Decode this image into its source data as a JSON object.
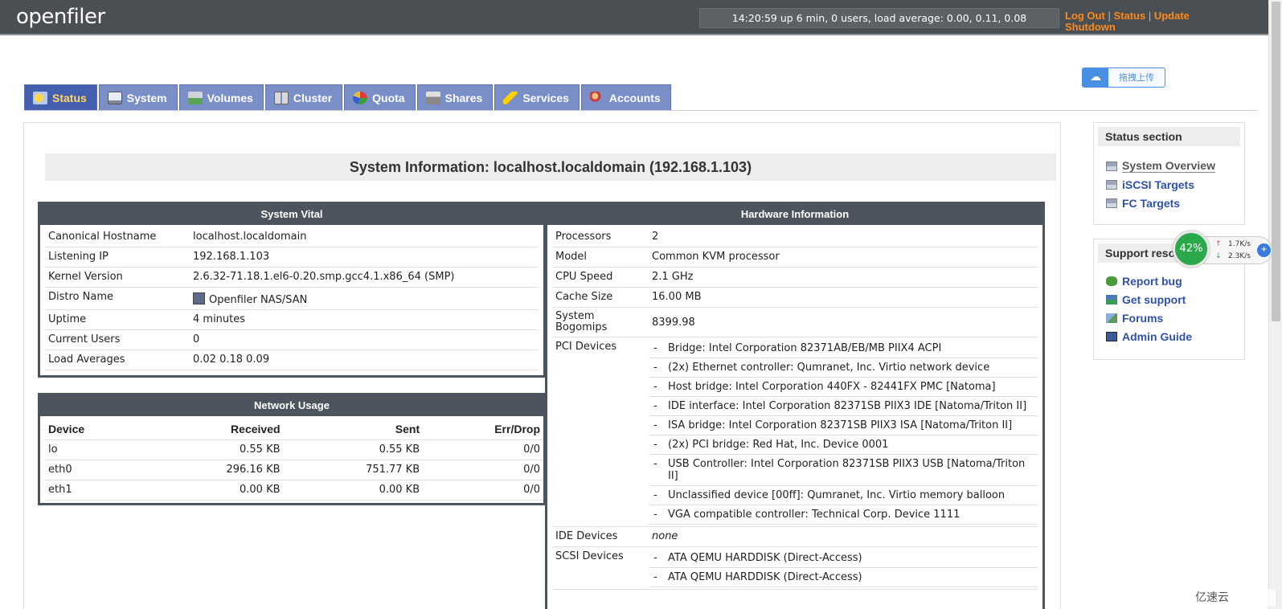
{
  "header": {
    "logo": "openfiler",
    "uptime": "14:20:59 up 6 min, 0 users, load average: 0.00, 0.11, 0.08",
    "links": {
      "logout": "Log Out",
      "status": "Status",
      "update": "Update",
      "shutdown": "Shutdown",
      "sep": "|"
    }
  },
  "upload_button": {
    "label": "拖拽上传"
  },
  "tabs": [
    {
      "label": "Status",
      "active": true,
      "icon": "sun-icon"
    },
    {
      "label": "System",
      "icon": "monitor-icon"
    },
    {
      "label": "Volumes",
      "icon": "disk-icon"
    },
    {
      "label": "Cluster",
      "icon": "server-icon"
    },
    {
      "label": "Quota",
      "icon": "pie-icon"
    },
    {
      "label": "Shares",
      "icon": "printer-icon"
    },
    {
      "label": "Services",
      "icon": "lightning-icon"
    },
    {
      "label": "Accounts",
      "icon": "users-icon"
    }
  ],
  "main": {
    "title": "System Information: localhost.localdomain (192.168.1.103)",
    "vital": {
      "heading": "System Vital",
      "rows": [
        {
          "key": "Canonical Hostname",
          "value": "localhost.localdomain"
        },
        {
          "key": "Listening IP",
          "value": "192.168.1.103"
        },
        {
          "key": "Kernel Version",
          "value": "2.6.32-71.18.1.el6-0.20.smp.gcc4.1.x86_64 (SMP)"
        },
        {
          "key": "Distro Name",
          "value": "Openfiler NAS/SAN"
        },
        {
          "key": "Uptime",
          "value": "4 minutes"
        },
        {
          "key": "Current Users",
          "value": "0"
        },
        {
          "key": "Load Averages",
          "value": "0.02 0.18 0.09"
        }
      ]
    },
    "network": {
      "heading": "Network Usage",
      "columns": [
        "Device",
        "Received",
        "Sent",
        "Err/Drop"
      ],
      "rows": [
        [
          "lo",
          "0.55 KB",
          "0.55 KB",
          "0/0"
        ],
        [
          "eth0",
          "296.16 KB",
          "751.77 KB",
          "0/0"
        ],
        [
          "eth1",
          "0.00 KB",
          "0.00 KB",
          "0/0"
        ]
      ]
    },
    "hardware": {
      "heading": "Hardware Information",
      "rows": [
        {
          "key": "Processors",
          "value": "2"
        },
        {
          "key": "Model",
          "value": "Common KVM processor"
        },
        {
          "key": "CPU Speed",
          "value": "2.1 GHz"
        },
        {
          "key": "Cache Size",
          "value": "16.00 MB"
        },
        {
          "key": "System Bogomips",
          "value": "8399.98"
        }
      ],
      "pci_label": "PCI Devices",
      "pci": [
        "Bridge: Intel Corporation 82371AB/EB/MB PIIX4 ACPI",
        "(2x) Ethernet controller: Qumranet, Inc. Virtio network device",
        "Host bridge: Intel Corporation 440FX - 82441FX PMC [Natoma]",
        "IDE interface: Intel Corporation 82371SB PIIX3 IDE [Natoma/Triton II]",
        "ISA bridge: Intel Corporation 82371SB PIIX3 ISA [Natoma/Triton II]",
        "(2x) PCI bridge: Red Hat, Inc. Device 0001",
        "USB Controller: Intel Corporation 82371SB PIIX3 USB [Natoma/Triton II]",
        "Unclassified device [00ff]: Qumranet, Inc. Virtio memory balloon",
        "VGA compatible controller: Technical Corp. Device 1111"
      ],
      "ide_label": "IDE Devices",
      "ide_value": "none",
      "scsi_label": "SCSI Devices",
      "scsi": [
        "ATA QEMU HARDDISK (Direct-Access)",
        "ATA QEMU HARDDISK (Direct-Access)"
      ]
    }
  },
  "sidebar": {
    "status_section": {
      "heading": "Status section",
      "links": [
        "System Overview",
        "iSCSI Targets",
        "FC Targets"
      ]
    },
    "support": {
      "heading": "Support reso",
      "links": [
        "Report bug",
        "Get support",
        "Forums",
        "Admin Guide"
      ]
    }
  },
  "speed_widget": {
    "percent": "42%",
    "up": "1.7K/s",
    "down": "2.3K/s",
    "up_arrow": "↑",
    "down_arrow": "↓",
    "plus": "+"
  },
  "watermark": "亿速云",
  "colors": {
    "header_bg": "#4a4f54",
    "link_orange": "#ff8a1a",
    "tab_active": "#435fae",
    "tab": "#7a8fc8",
    "box_head": "#4c555e",
    "sidebar_link": "#2f52a8",
    "speed_green": "#2aa84a"
  }
}
